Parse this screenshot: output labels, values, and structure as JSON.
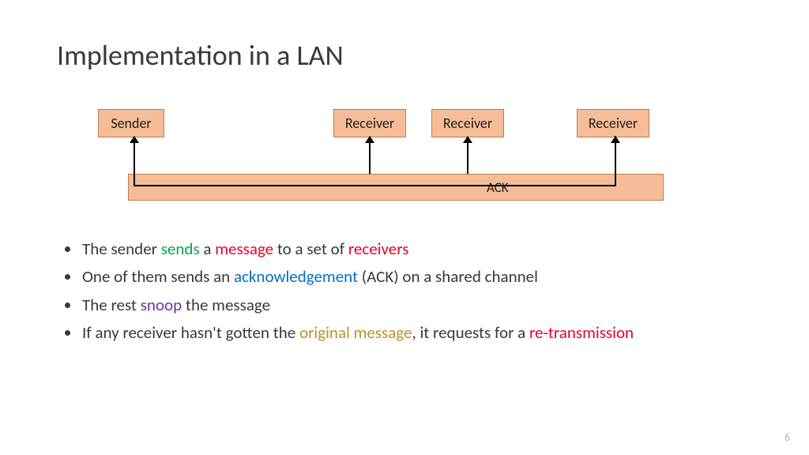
{
  "title": "Implementation in a LAN",
  "diagram": {
    "sender": "Sender",
    "receiver1": "Receiver",
    "receiver2": "Receiver",
    "receiver3": "Receiver",
    "ack": "ACK"
  },
  "bullets": {
    "b1": {
      "t1": "The sender ",
      "sends": "sends",
      "t2": " a ",
      "message": "message",
      "t3": " to a set of ",
      "receivers": "receivers"
    },
    "b2": {
      "t1": "One of them sends an ",
      "ack": "acknowledgement",
      "t2": " (ACK) on a shared channel"
    },
    "b3": {
      "t1": "The rest ",
      "snoop": "snoop",
      "t2": " the message"
    },
    "b4": {
      "t1": "If any receiver hasn't gotten the ",
      "orig": "original message",
      "t2": ", it requests for a ",
      "retrans": "re-transmission"
    }
  },
  "slide_number": "6"
}
